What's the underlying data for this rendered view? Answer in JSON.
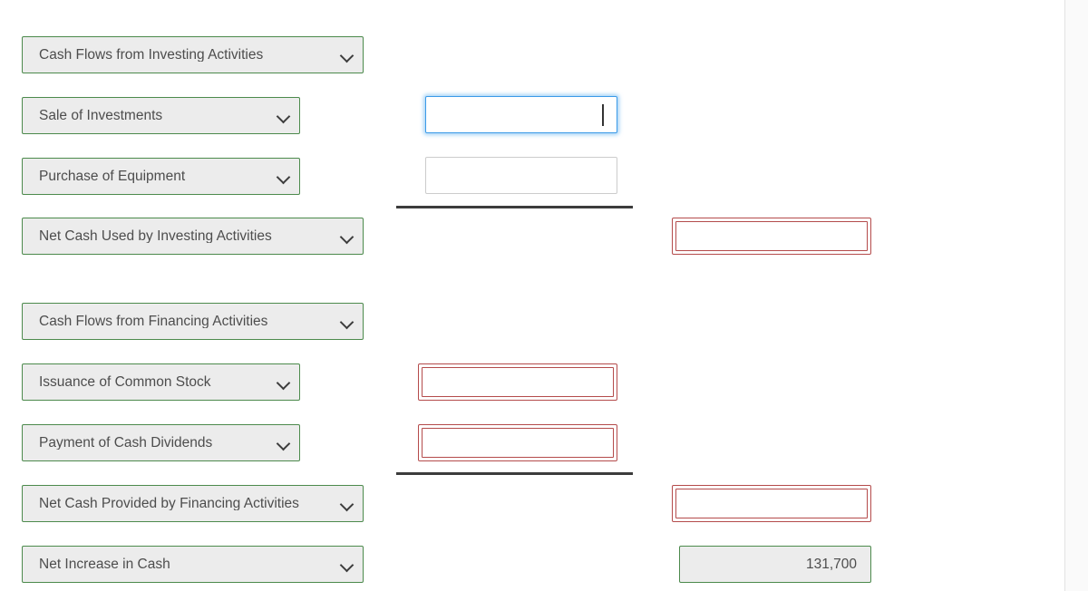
{
  "statement": {
    "sections": [
      {
        "name": "investing",
        "header": {
          "label": "Cash Flows from Investing Activities"
        },
        "lines": [
          {
            "label": "Sale of Investments",
            "amount": "",
            "state": "focused"
          },
          {
            "label": "Purchase of Equipment",
            "amount": "",
            "state": "empty"
          }
        ],
        "subtotal": {
          "label": "Net Cash Used by Investing Activities",
          "amount": "",
          "state": "error"
        }
      },
      {
        "name": "financing",
        "header": {
          "label": "Cash Flows from Financing Activities"
        },
        "lines": [
          {
            "label": "Issuance of Common Stock",
            "amount": "",
            "state": "error"
          },
          {
            "label": "Payment of Cash Dividends",
            "amount": "",
            "state": "error"
          }
        ],
        "subtotal": {
          "label": "Net Cash Provided by Financing Activities",
          "amount": "",
          "state": "error"
        }
      }
    ],
    "net_increase": {
      "label": "Net Increase in Cash",
      "amount": "131,700"
    }
  },
  "icons": {
    "chevron": "chevron-down-icon"
  },
  "colors": {
    "select_border": "#4c8a4c",
    "select_fill": "#ececec",
    "error_border": "#b44b4b",
    "focus_border": "#3b9ae8",
    "rule": "#3c3c3c",
    "text": "#4d4d4d"
  }
}
